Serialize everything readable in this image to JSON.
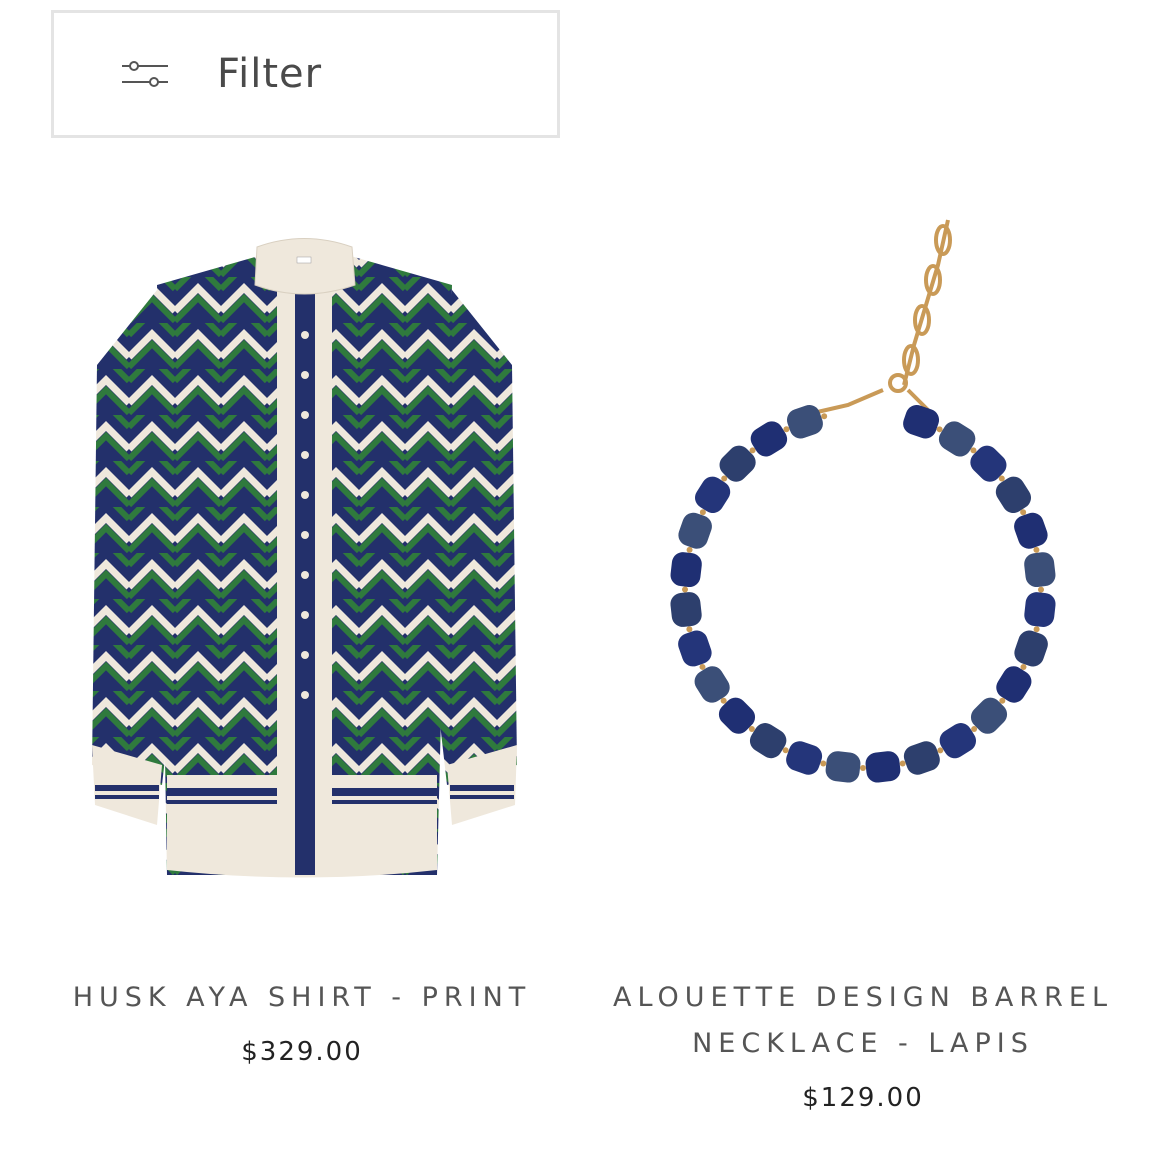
{
  "filter": {
    "label": "Filter",
    "icon": "sliders-icon"
  },
  "products": [
    {
      "title": "HUSK AYA SHIRT - PRINT",
      "price": "$329.00",
      "image_icon": "shirt-image",
      "colors": {
        "navy": "#23306b",
        "green": "#2f7a3d",
        "cream": "#efe8dc"
      }
    },
    {
      "title": "ALOUETTE DESIGN BARREL NECKLACE - LAPIS",
      "price": "$129.00",
      "image_icon": "necklace-image",
      "colors": {
        "lapis": "#26366f",
        "gold": "#c99a57"
      }
    }
  ]
}
